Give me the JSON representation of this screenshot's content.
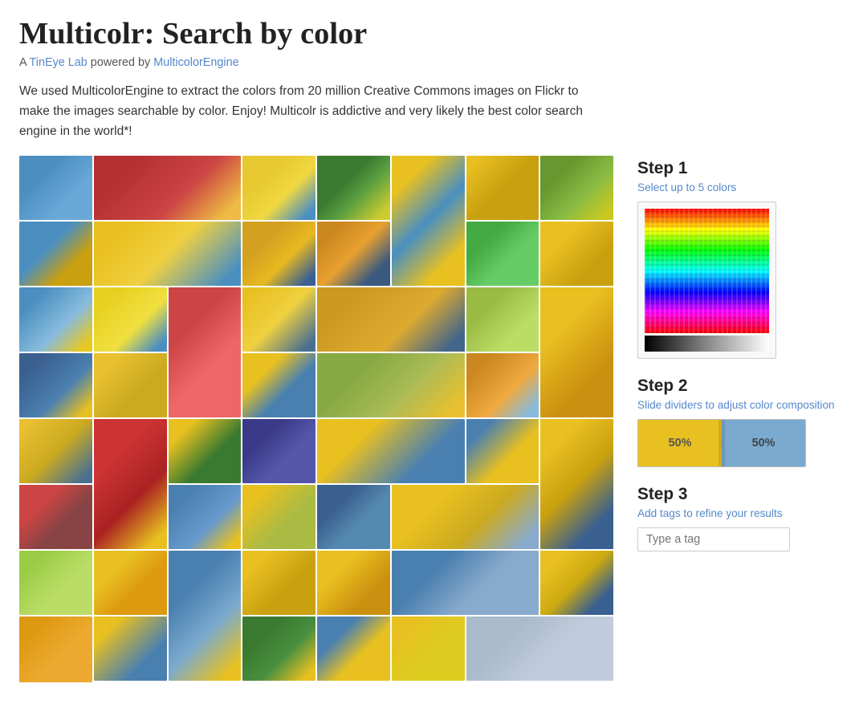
{
  "header": {
    "title": "Multicolr: Search by color",
    "subtitle_prefix": "A ",
    "tineye_label": "TinEye Lab",
    "powered_by": " powered by ",
    "engine_label": "MulticolorEngine"
  },
  "description": {
    "text": "We used MulticolorEngine to extract the colors from 20 million Creative Commons images on Flickr to make the images searchable by color. Enjoy! Multicolr is addictive and very likely the best color search engine in the world*!"
  },
  "steps": {
    "step1": {
      "title": "Step 1",
      "subtitle": "Select up to 5 colors"
    },
    "step2": {
      "title": "Step 2",
      "subtitle": "Slide dividers to adjust color composition",
      "bar1_label": "50%",
      "bar2_label": "50%"
    },
    "step3": {
      "title": "Step 3",
      "subtitle": "Add tags to refine your results",
      "tag_placeholder": "Type a tag"
    }
  }
}
